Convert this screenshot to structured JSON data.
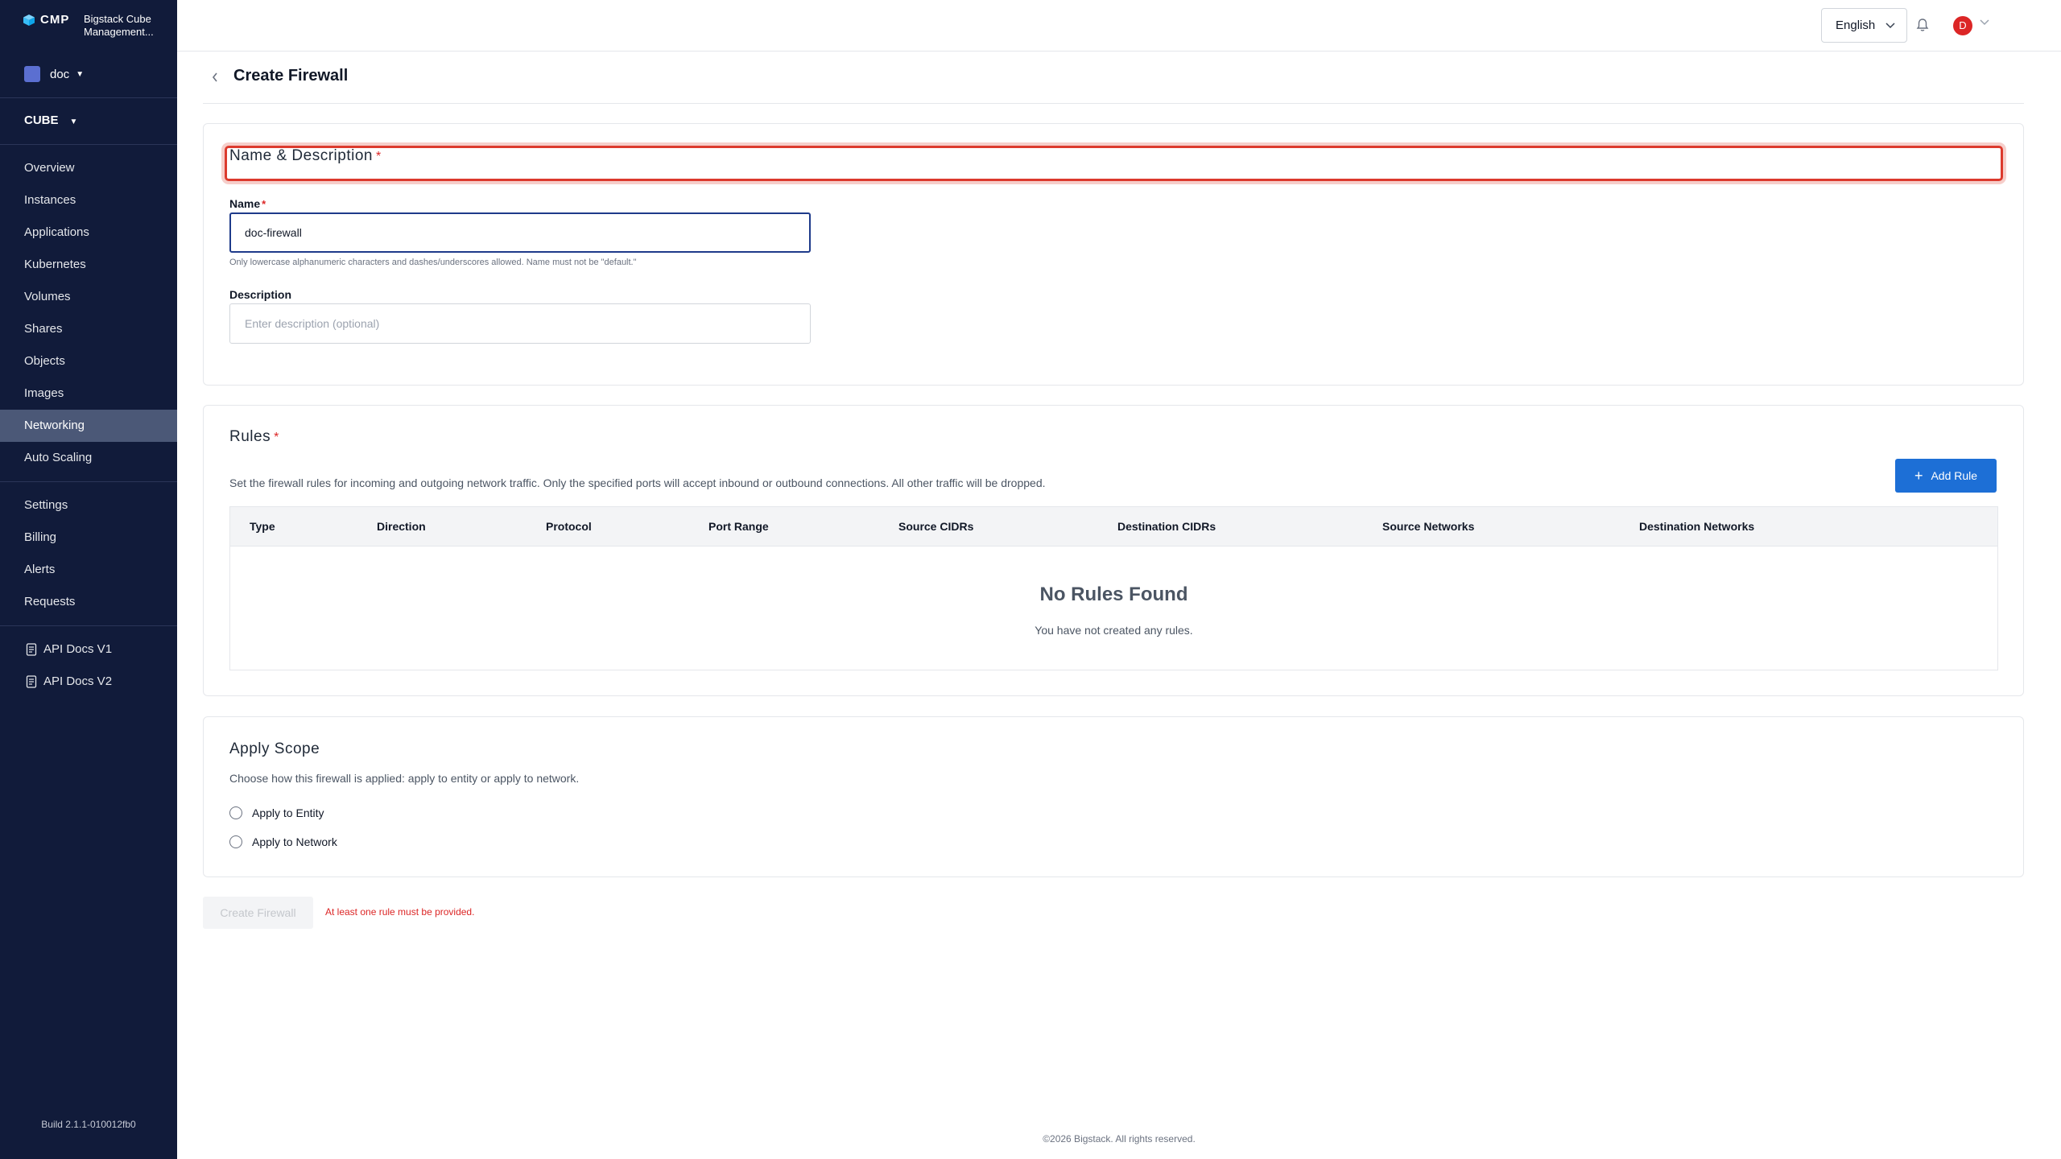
{
  "app": {
    "logo_text": "CMP",
    "full_name": "Bigstack Cube Management...",
    "build": "Build 2.1.1-010012fb0"
  },
  "sidebar": {
    "project": "doc",
    "cube": "CUBE",
    "nav": [
      {
        "label": "Overview"
      },
      {
        "label": "Instances"
      },
      {
        "label": "Applications"
      },
      {
        "label": "Kubernetes"
      },
      {
        "label": "Volumes"
      },
      {
        "label": "Shares"
      },
      {
        "label": "Objects"
      },
      {
        "label": "Images"
      },
      {
        "label": "Networking",
        "active": true
      },
      {
        "label": "Auto Scaling"
      }
    ],
    "nav2": [
      {
        "label": "Settings"
      },
      {
        "label": "Billing"
      },
      {
        "label": "Alerts"
      },
      {
        "label": "Requests"
      }
    ],
    "docs": [
      {
        "label": "API Docs V1"
      },
      {
        "label": "API Docs V2"
      }
    ]
  },
  "topbar": {
    "language": "English",
    "avatar_initial": "D",
    "avatar_color": "#dc2626"
  },
  "page": {
    "title": "Create Firewall"
  },
  "name_section": {
    "title": "Name & Description",
    "required_mark": "*",
    "name_label": "Name",
    "name_value": "doc-firewall",
    "name_hint": "Only lowercase alphanumeric characters and dashes/underscores allowed. Name must not be \"default.\"",
    "description_label": "Description",
    "description_placeholder": "Enter description (optional)"
  },
  "rules_section": {
    "title": "Rules",
    "required_mark": "*",
    "description": "Set the firewall rules for incoming and outgoing network traffic. Only the specified ports will accept inbound or outbound connections. All other traffic will be dropped.",
    "add_button": "Add Rule",
    "columns": [
      "Type",
      "Direction",
      "Protocol",
      "Port Range",
      "Source CIDRs",
      "Destination CIDRs",
      "Source Networks",
      "Destination Networks"
    ],
    "empty_title": "No Rules Found",
    "empty_subtitle": "You have not created any rules."
  },
  "scope_section": {
    "title": "Apply Scope",
    "description": "Choose how this firewall is applied: apply to entity or apply to network.",
    "options": [
      "Apply to Entity",
      "Apply to Network"
    ]
  },
  "actions": {
    "create_button": "Create Firewall",
    "error": "At least one rule must be provided."
  },
  "footer": {
    "copyright": "©2026 Bigstack. All rights reserved."
  },
  "colors": {
    "sidebar_bg": "#111b3a",
    "primary": "#1d6fd6",
    "error": "#dc2626"
  }
}
